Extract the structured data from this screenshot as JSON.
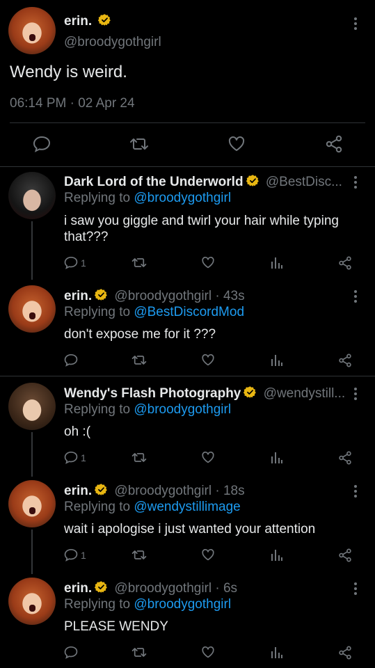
{
  "main_tweet": {
    "display_name": "erin.",
    "handle": "@broodygothgirl",
    "text": "Wendy is weird.",
    "timestamp": "06:14 PM · 02 Apr 24"
  },
  "replies": [
    {
      "display_name": "Dark Lord of the Underworld",
      "handle": "@BestDisc...",
      "replying_prefix": "Replying to ",
      "replying_to": "@broodygothgirl",
      "text_lines": [
        "i saw you giggle and twirl your hair while typing",
        "that???"
      ],
      "reply_count": "1"
    },
    {
      "display_name": "erin.",
      "handle": "@broodygothgirl · 43s",
      "replying_prefix": "Replying to ",
      "replying_to": "@BestDiscordMod",
      "text_lines": [
        "don't expose me for it ???"
      ],
      "reply_count": ""
    },
    {
      "display_name": "Wendy's Flash Photography",
      "handle": "@wendystill...",
      "replying_prefix": "Replying to ",
      "replying_to": "@broodygothgirl",
      "text_lines": [
        "oh :("
      ],
      "reply_count": "1"
    },
    {
      "display_name": "erin.",
      "handle": "@broodygothgirl · 18s",
      "replying_prefix": "Replying to ",
      "replying_to": "@wendystillimage",
      "text_lines": [
        "wait i apologise i just wanted your attention"
      ],
      "reply_count": "1"
    },
    {
      "display_name": "erin.",
      "handle": "@broodygothgirl · 6s",
      "replying_prefix": "Replying to ",
      "replying_to": "@broodygothgirl",
      "text_lines": [
        "PLEASE WENDY"
      ],
      "reply_count": ""
    }
  ],
  "icons": {
    "reply": "reply-icon",
    "retweet": "retweet-icon",
    "like": "heart-icon",
    "views": "views-icon",
    "share": "share-icon",
    "verified": "verified-badge-icon",
    "menu": "more-vertical-icon"
  },
  "colors": {
    "background": "#000000",
    "text": "#e7e9ea",
    "muted": "#71767b",
    "link": "#1d9bf0",
    "verified": "#e8b612"
  }
}
